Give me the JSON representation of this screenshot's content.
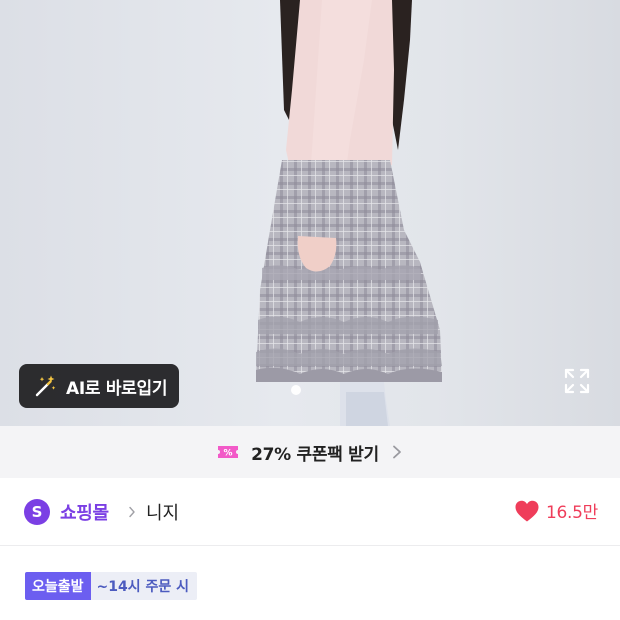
{
  "product_image": {
    "ai_button_label": "AI로 바로입기",
    "ai_icon": "magic-wand-icon",
    "expand_icon": "expand-icon"
  },
  "coupon_bar": {
    "icon": "coupon-ticket-icon",
    "label": "27% 쿠폰팩 받기",
    "chevron": "chevron-right-icon",
    "accent": "#f25ac8"
  },
  "store": {
    "logo_letter": "S",
    "name": "쇼핑몰",
    "brand": "니지",
    "like_count": "16.5만",
    "brand_color": "#7b3fe4",
    "like_color": "#ef3d5a"
  },
  "delivery": {
    "badge": "오늘출발",
    "cutoff": "~14시 주문 시"
  }
}
